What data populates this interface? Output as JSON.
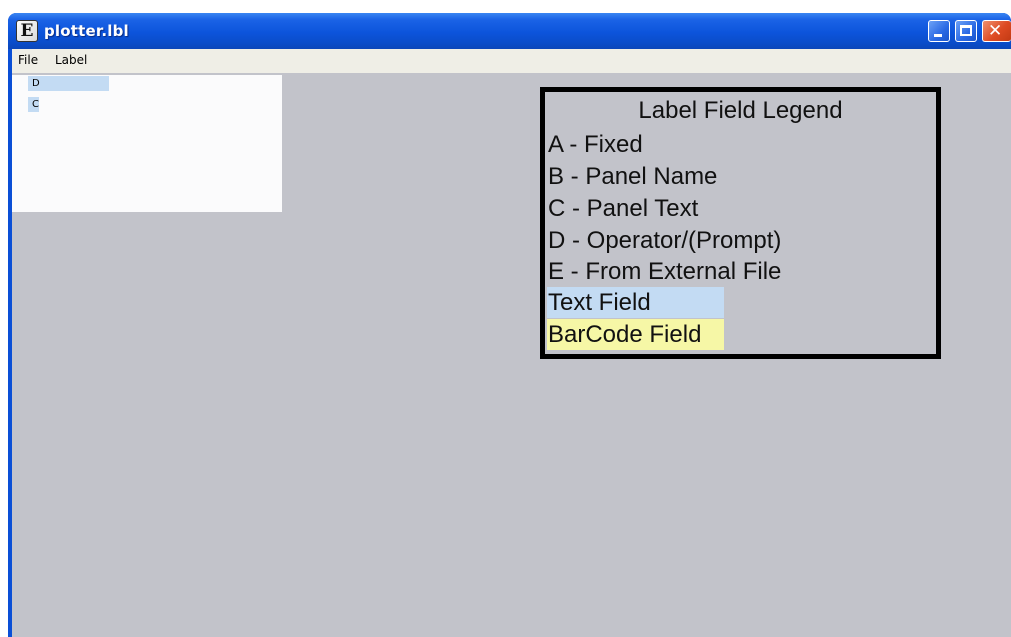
{
  "window": {
    "title": "plotter.lbl",
    "app_icon": "E",
    "controls": {
      "minimize_icon": "minimize-icon",
      "maximize_icon": "maximize-icon",
      "close_icon": "close-icon",
      "close_glyph": "✕"
    }
  },
  "menu": {
    "items": [
      {
        "label": "File"
      },
      {
        "label": "Label"
      }
    ]
  },
  "field_panel": {
    "fields": [
      {
        "label": "D"
      },
      {
        "label": "C"
      }
    ]
  },
  "legend": {
    "title": "Label Field Legend",
    "entries": [
      {
        "label": "A - Fixed"
      },
      {
        "label": "B - Panel Name"
      },
      {
        "label": "C - Panel Text"
      },
      {
        "label": "D - Operator/(Prompt)"
      },
      {
        "label": "E - From External File"
      }
    ],
    "text_field": {
      "label": "Text Field",
      "color": "#c3dbf3"
    },
    "barcode_field": {
      "label": "BarCode Field",
      "color": "#f6f7a6"
    }
  },
  "colors": {
    "titlebar": "#0c54db",
    "workspace": "#c2c3ca",
    "menubar": "#efeee6"
  }
}
